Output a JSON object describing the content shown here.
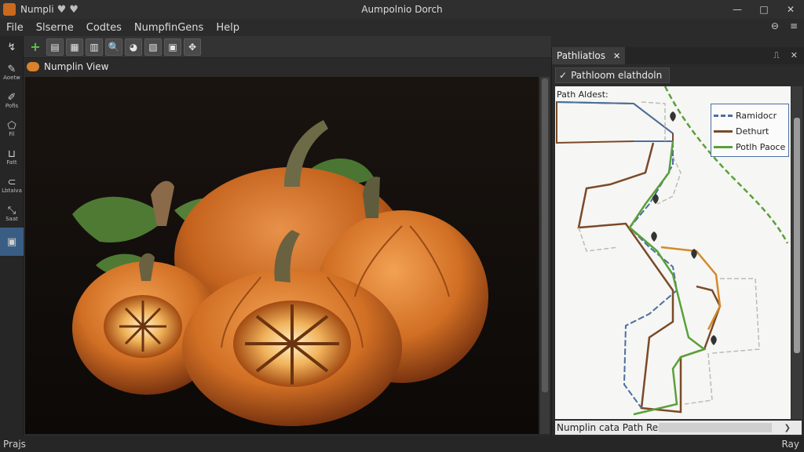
{
  "window": {
    "app_name": "Numpli",
    "title": "Aumpolnio Dorch",
    "minimize": "—",
    "maximize": "□",
    "close": "✕"
  },
  "menu": {
    "items": [
      "File",
      "Slserne",
      "Codtes",
      "NumpfinGens",
      "Help"
    ],
    "right_icons": [
      "⊖",
      "≡"
    ]
  },
  "toolbar": {
    "buttons": [
      "+",
      "▤",
      "▦",
      "▥",
      "🔍",
      "◕",
      "▧",
      "▣",
      "✥"
    ]
  },
  "left_rail": {
    "top_icon": "↯",
    "items": [
      {
        "label": "Aoetw",
        "icon": "✎"
      },
      {
        "label": "Pofis",
        "icon": "✐"
      },
      {
        "label": "Fil",
        "icon": "⬠"
      },
      {
        "label": "Fatt",
        "icon": "⊔"
      },
      {
        "label": "Lbtaiva",
        "icon": "⊂"
      },
      {
        "label": "Saat",
        "icon": "⤡"
      },
      {
        "label": "",
        "icon": "▣"
      }
    ]
  },
  "viewer": {
    "title": "Numplin View"
  },
  "panel": {
    "tab_label": "Pathliatlos",
    "tab_close": "✕",
    "subhead": "Pathloom elathdoln",
    "checkmark": "✓",
    "controls": [
      "⎍",
      "✕"
    ],
    "map_label": "Path Aldest:",
    "legend": [
      {
        "label": "Ramidocr",
        "color": "#4a6fa0"
      },
      {
        "label": "Dethurt",
        "color": "#7a4a28"
      },
      {
        "label": "Potlh Paoce",
        "color": "#5aa03a"
      }
    ],
    "result_text": "Numplin cata Path Result",
    "result_arrow": "❯"
  },
  "status": {
    "left": "Prajs",
    "right": "Ray"
  },
  "colors": {
    "pumpkin": "#d9822b",
    "selection": "#3a5d84",
    "route_blue": "#4a6fa0",
    "route_brown": "#7a4a28",
    "route_green": "#5aa03a",
    "route_orange": "#d38a2a"
  }
}
